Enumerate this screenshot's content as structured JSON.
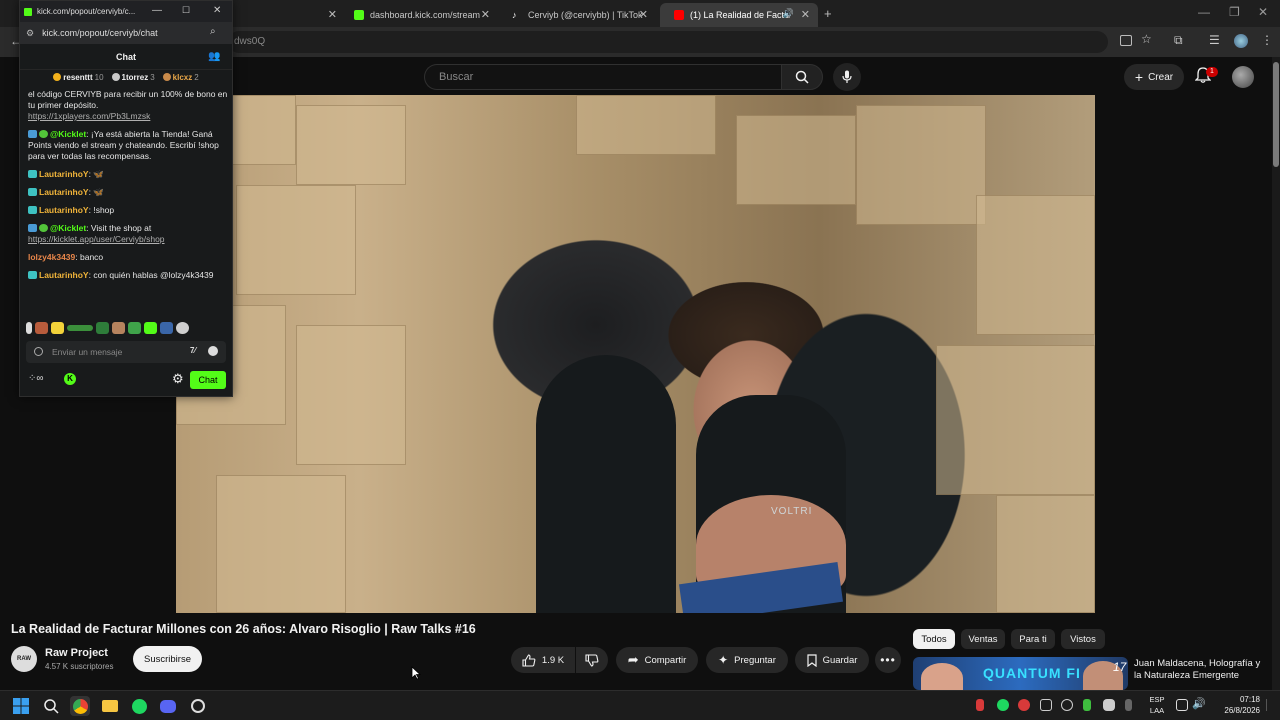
{
  "browser": {
    "tabs": [
      {
        "label": "dashboard.kick.com/stream",
        "icon_color": "#53fc18"
      },
      {
        "label": "Cerviyb (@cerviybb) | TikTok",
        "icon_color": "#ffffff"
      },
      {
        "label": "(1) La Realidad de Facturar M",
        "icon_color": "#ff0000"
      }
    ],
    "address_fragment": "dws0Q"
  },
  "kick": {
    "window_title": "kick.com/popout/cerviyb/c...",
    "url": "kick.com/popout/cerviyb/chat",
    "header_title": "Chat",
    "leaders": [
      {
        "name": "resenttt",
        "count": "10",
        "color": "#f2b11c"
      },
      {
        "name": "1torrez",
        "count": "3",
        "color": "#c8c8c8"
      },
      {
        "name": "klcxz",
        "count": "2",
        "color": "#c98a4a"
      }
    ],
    "messages": [
      {
        "type": "plain",
        "text": "el código CERVIYB para recibir un 100% de bono en tu primer depósito.",
        "link": "https://1xplayers.com/Pb3Lmzsk"
      },
      {
        "type": "bot",
        "user": "@Kicklet",
        "text": "¡Ya está abierta la Tienda! Ganá Points viendo el stream y chateando. Escribí !shop para ver todas las recompensas."
      },
      {
        "type": "user",
        "user": "LautarinhoY",
        "text": "🦋"
      },
      {
        "type": "user",
        "user": "LautarinhoY",
        "text": "🦋"
      },
      {
        "type": "user",
        "user": "LautarinhoY",
        "text": "!shop"
      },
      {
        "type": "bot",
        "user": "@Kicklet",
        "text": "Visit the shop at",
        "link": "https://kicklet.app/user/Cerviyb/shop"
      },
      {
        "type": "user2",
        "user": "lolzy4k3439",
        "text": "banco"
      },
      {
        "type": "user",
        "user": "LautarinhoY",
        "text": "con quién hablas @lolzy4k3439"
      }
    ],
    "input_placeholder": "Enviar un mensaje",
    "chat_button": "Chat",
    "accent": "#53fc18"
  },
  "youtube": {
    "search_placeholder": "Buscar",
    "create_label": "Crear",
    "notif_count": "1",
    "video_title": "La Realidad de Facturar Millones con 26 años: Alvaro Risoglio | Raw Talks #16",
    "channel": {
      "name": "Raw Project",
      "subs": "4.57 K suscriptores",
      "avatar_text": "RAW"
    },
    "subscribe": "Suscribirse",
    "likes": "1.9 K",
    "share": "Compartir",
    "ask": "Preguntar",
    "save": "Guardar",
    "chips": [
      "Todos",
      "Ventas",
      "Para ti",
      "Vistos"
    ],
    "recommended": {
      "title": "Juan Maldacena, Holografía y la Naturaleza Emergente",
      "thumb_text": "QUANTUM FI",
      "duration": "17"
    },
    "shirt_text": "VOLTRI"
  },
  "taskbar": {
    "lang": "ESP",
    "region": "LAA",
    "time": "07:18",
    "date": "26/8/2026"
  }
}
